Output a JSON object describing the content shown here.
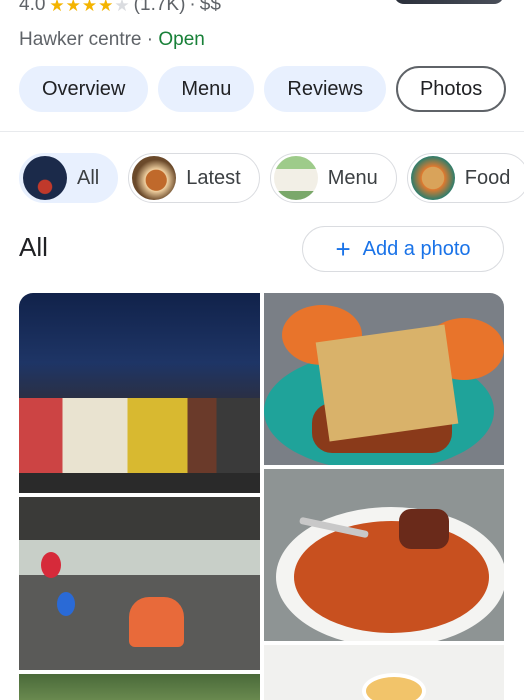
{
  "header": {
    "rating": "4.0",
    "stars": [
      true,
      true,
      true,
      true,
      false
    ],
    "review_count": "(1.7K)",
    "price": "$$",
    "separator": "·",
    "category": "Hawker centre",
    "status": "Open"
  },
  "tabs": [
    {
      "label": "Overview",
      "active": false
    },
    {
      "label": "Menu",
      "active": false
    },
    {
      "label": "Reviews",
      "active": false
    },
    {
      "label": "Photos",
      "active": true
    }
  ],
  "filters": [
    {
      "label": "All",
      "selected": true
    },
    {
      "label": "Latest",
      "selected": false
    },
    {
      "label": "Menu",
      "selected": false
    },
    {
      "label": "Food",
      "selected": false
    }
  ],
  "section": {
    "title": "All",
    "add_photo_label": "Add a photo",
    "add_icon": "plus-icon"
  },
  "colors": {
    "accent": "#1a73e8",
    "open_green": "#188038",
    "tab_bg": "#e8f0fe",
    "star": "#f4b400"
  }
}
